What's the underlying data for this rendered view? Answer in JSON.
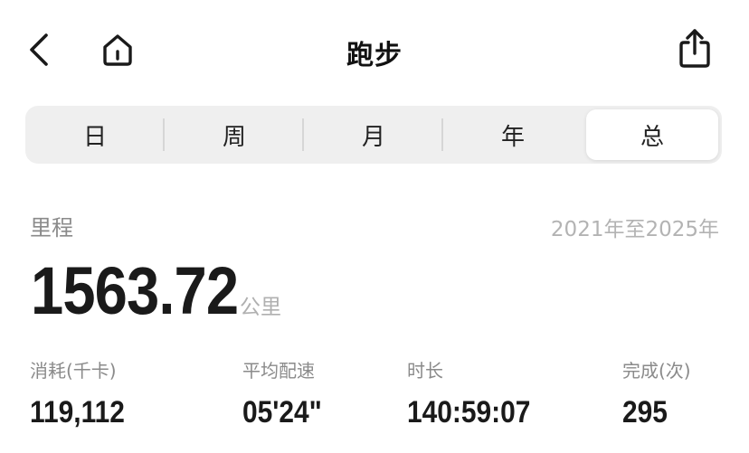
{
  "header": {
    "title": "跑步",
    "back_icon": "chevron-left-icon",
    "home_icon": "home-icon",
    "share_icon": "share-icon"
  },
  "tabs": [
    {
      "label": "日",
      "active": false
    },
    {
      "label": "周",
      "active": false
    },
    {
      "label": "月",
      "active": false
    },
    {
      "label": "年",
      "active": false
    },
    {
      "label": "总",
      "active": true
    }
  ],
  "distance": {
    "label": "里程",
    "range": "2021年至2025年",
    "value": "1563.72",
    "unit": "公里"
  },
  "stats": [
    {
      "label": "消耗(千卡)",
      "value": "119,112"
    },
    {
      "label": "平均配速",
      "value": "05'24\""
    },
    {
      "label": "时长",
      "value": "140:59:07"
    },
    {
      "label": "完成(次)",
      "value": "295"
    }
  ]
}
